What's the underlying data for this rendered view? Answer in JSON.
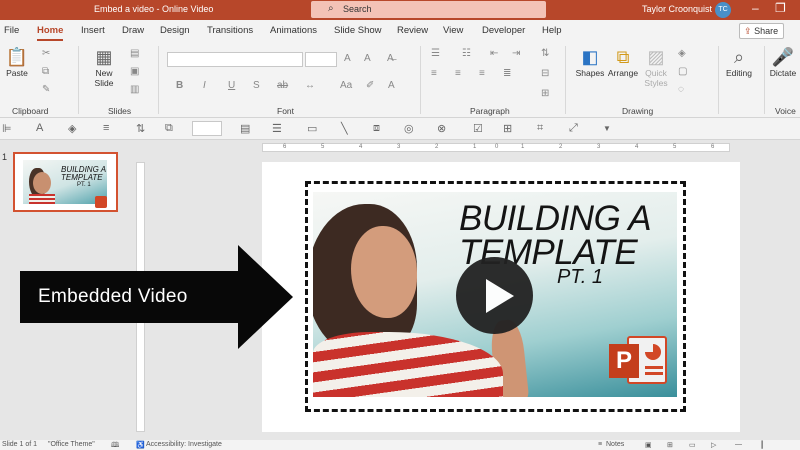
{
  "titlebar": {
    "doc_title": "Embed a video - Online Video",
    "search_placeholder": "Search",
    "user_name": "Taylor Croonquist",
    "user_initials": "TC",
    "brand_color": "#b7472a"
  },
  "tabs": [
    "File",
    "Home",
    "Insert",
    "Draw",
    "Design",
    "Transitions",
    "Animations",
    "Slide Show",
    "Review",
    "View",
    "Developer",
    "Help"
  ],
  "active_tab": "Home",
  "share_label": "Share",
  "ribbon": {
    "paste": "Paste",
    "new_slide": "New Slide",
    "shapes": "Shapes",
    "arrange": "Arrange",
    "quick_styles": "Quick Styles",
    "editing": "Editing",
    "dictate": "Dictate",
    "groups": {
      "clipboard": "Clipboard",
      "slides": "Slides",
      "font": "Font",
      "paragraph": "Paragraph",
      "drawing": "Drawing",
      "voice": "Voice"
    },
    "font_buttons": [
      "B",
      "I",
      "U",
      "S",
      "ab"
    ]
  },
  "slide_panel": {
    "slide_number": "1",
    "thumb_title": "BUILDING A TEMPLATE",
    "thumb_sub": "PT. 1"
  },
  "video": {
    "title_line1": "BUILDING A",
    "title_line2": "TEMPLATE",
    "subtitle": "PT. 1",
    "logo_letter": "P"
  },
  "annotation": {
    "label": "Embedded Video"
  },
  "ruler_numbers": [
    "6",
    "5",
    "4",
    "3",
    "2",
    "1",
    "0",
    "1",
    "2",
    "3",
    "4",
    "5",
    "6"
  ],
  "statusbar": {
    "slide_info": "Slide 1 of 1",
    "theme": "\"Office Theme\"",
    "accessibility": "Accessibility: Investigate",
    "notes": "Notes"
  }
}
